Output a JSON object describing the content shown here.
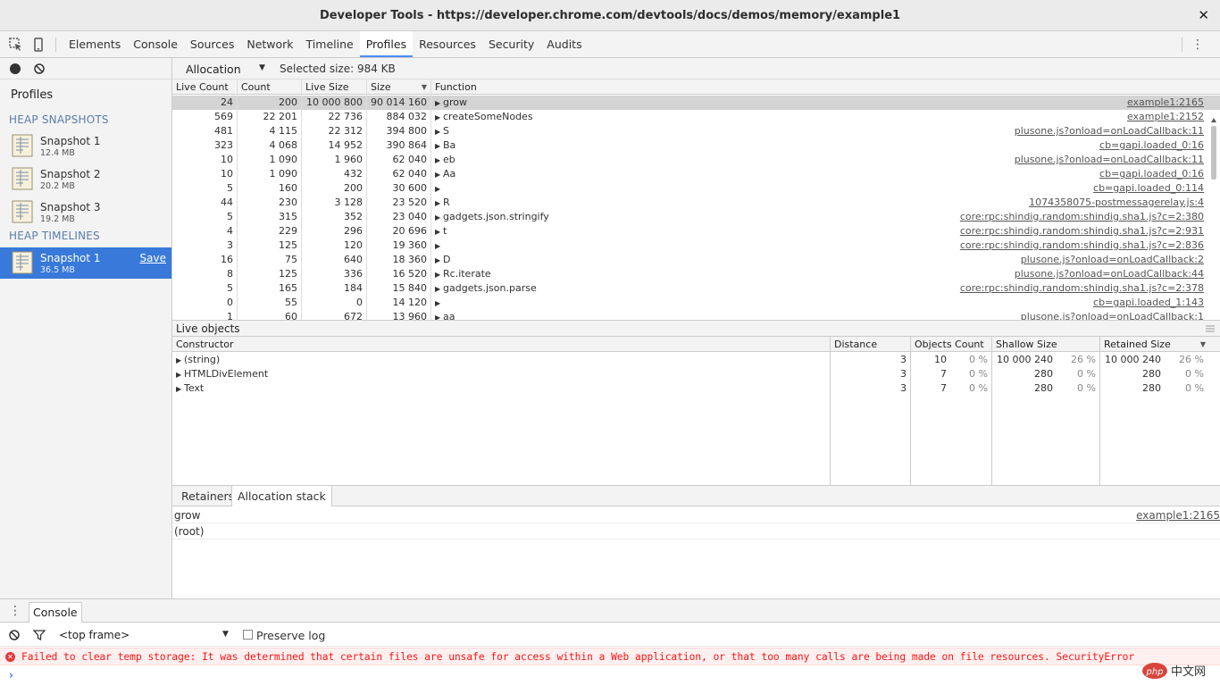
{
  "window": {
    "title": "Developer Tools - https://developer.chrome.com/devtools/docs/demos/memory/example1",
    "close": "✕"
  },
  "tabs": [
    "Elements",
    "Console",
    "Sources",
    "Network",
    "Timeline",
    "Profiles",
    "Resources",
    "Security",
    "Audits"
  ],
  "active_tab": "Profiles",
  "sidebar": {
    "title": "Profiles",
    "heap_snapshots_label": "HEAP SNAPSHOTS",
    "heap_timelines_label": "HEAP TIMELINES",
    "snapshots": [
      {
        "name": "Snapshot 1",
        "size": "12.4 MB"
      },
      {
        "name": "Snapshot 2",
        "size": "20.2 MB"
      },
      {
        "name": "Snapshot 3",
        "size": "19.2 MB"
      }
    ],
    "timeline": {
      "name": "Snapshot 1",
      "size": "36.5 MB",
      "save": "Save"
    }
  },
  "allocation": {
    "view": "Allocation",
    "selected_size": "Selected size: 984 KB"
  },
  "top_grid": {
    "columns": [
      "Live Count",
      "Count",
      "Live Size",
      "Size",
      "Function"
    ],
    "rows": [
      {
        "lc": "24",
        "c": "200",
        "ls": "10 000 800",
        "s": "90 014 160",
        "fn": "grow",
        "src": "example1:2165"
      },
      {
        "lc": "569",
        "c": "22 201",
        "ls": "22 736",
        "s": "884 032",
        "fn": "createSomeNodes",
        "src": "example1:2152"
      },
      {
        "lc": "481",
        "c": "4 115",
        "ls": "22 312",
        "s": "394 800",
        "fn": "S",
        "src": "plusone.js?onload=onLoadCallback:11"
      },
      {
        "lc": "323",
        "c": "4 068",
        "ls": "14 952",
        "s": "390 864",
        "fn": "Ba",
        "src": "cb=gapi.loaded_0:16"
      },
      {
        "lc": "10",
        "c": "1 090",
        "ls": "1 960",
        "s": "62 040",
        "fn": "eb",
        "src": "plusone.js?onload=onLoadCallback:11"
      },
      {
        "lc": "10",
        "c": "1 090",
        "ls": "432",
        "s": "62 040",
        "fn": "Aa",
        "src": "cb=gapi.loaded_0:16"
      },
      {
        "lc": "5",
        "c": "160",
        "ls": "200",
        "s": "30 600",
        "fn": "",
        "src": "cb=gapi.loaded_0:114"
      },
      {
        "lc": "44",
        "c": "230",
        "ls": "3 128",
        "s": "23 520",
        "fn": "R",
        "src": "1074358075-postmessagerelay.js:4"
      },
      {
        "lc": "5",
        "c": "315",
        "ls": "352",
        "s": "23 040",
        "fn": "gadgets.json.stringify",
        "src": "core:rpc:shindig.random:shindig.sha1.js?c=2:380"
      },
      {
        "lc": "4",
        "c": "229",
        "ls": "296",
        "s": "20 696",
        "fn": "t",
        "src": "core:rpc:shindig.random:shindig.sha1.js?c=2:931"
      },
      {
        "lc": "3",
        "c": "125",
        "ls": "120",
        "s": "19 360",
        "fn": "",
        "src": "core:rpc:shindig.random:shindig.sha1.js?c=2:836"
      },
      {
        "lc": "16",
        "c": "75",
        "ls": "640",
        "s": "18 360",
        "fn": "D",
        "src": "plusone.js?onload=onLoadCallback:2"
      },
      {
        "lc": "8",
        "c": "125",
        "ls": "336",
        "s": "16 520",
        "fn": "Rc.iterate",
        "src": "plusone.js?onload=onLoadCallback:44"
      },
      {
        "lc": "5",
        "c": "165",
        "ls": "184",
        "s": "15 840",
        "fn": "gadgets.json.parse",
        "src": "core:rpc:shindig.random:shindig.sha1.js?c=2:378"
      },
      {
        "lc": "0",
        "c": "55",
        "ls": "0",
        "s": "14 120",
        "fn": "",
        "src": "cb=gapi.loaded_1:143"
      },
      {
        "lc": "1",
        "c": "60",
        "ls": "672",
        "s": "13 960",
        "fn": "aa",
        "src": "plusone.js?onload=onLoadCallback:1"
      }
    ]
  },
  "live_objects": {
    "title": "Live objects",
    "columns": [
      "Constructor",
      "Distance",
      "Objects Count",
      "Shallow Size",
      "Retained Size"
    ],
    "rows": [
      {
        "ctor": "(string)",
        "dist": "3",
        "count": "10",
        "count_pct": "0 %",
        "shallow": "10 000 240",
        "shallow_pct": "26 %",
        "retained": "10 000 240",
        "retained_pct": "26 %"
      },
      {
        "ctor": "HTMLDivElement",
        "dist": "3",
        "count": "7",
        "count_pct": "0 %",
        "shallow": "280",
        "shallow_pct": "0 %",
        "retained": "280",
        "retained_pct": "0 %"
      },
      {
        "ctor": "Text",
        "dist": "3",
        "count": "7",
        "count_pct": "0 %",
        "shallow": "280",
        "shallow_pct": "0 %",
        "retained": "280",
        "retained_pct": "0 %"
      }
    ]
  },
  "bottom_tabs": [
    "Retainers",
    "Allocation stack"
  ],
  "stack": [
    {
      "fn": "grow",
      "src": "example1:2165"
    },
    {
      "fn": "(root)",
      "src": ""
    }
  ],
  "console": {
    "tab": "Console",
    "frame": "<top frame>",
    "preserve_log": "Preserve log",
    "error": "Failed to clear temp storage: It was determined that certain files are unsafe for access within a Web application, or that too many calls are being made on file resources. SecurityError",
    "prompt": "›"
  },
  "watermark": "php中文网",
  "colors": {
    "accent": "#4a8cf7",
    "selection": "#3879d9",
    "error": "#ff1111"
  }
}
